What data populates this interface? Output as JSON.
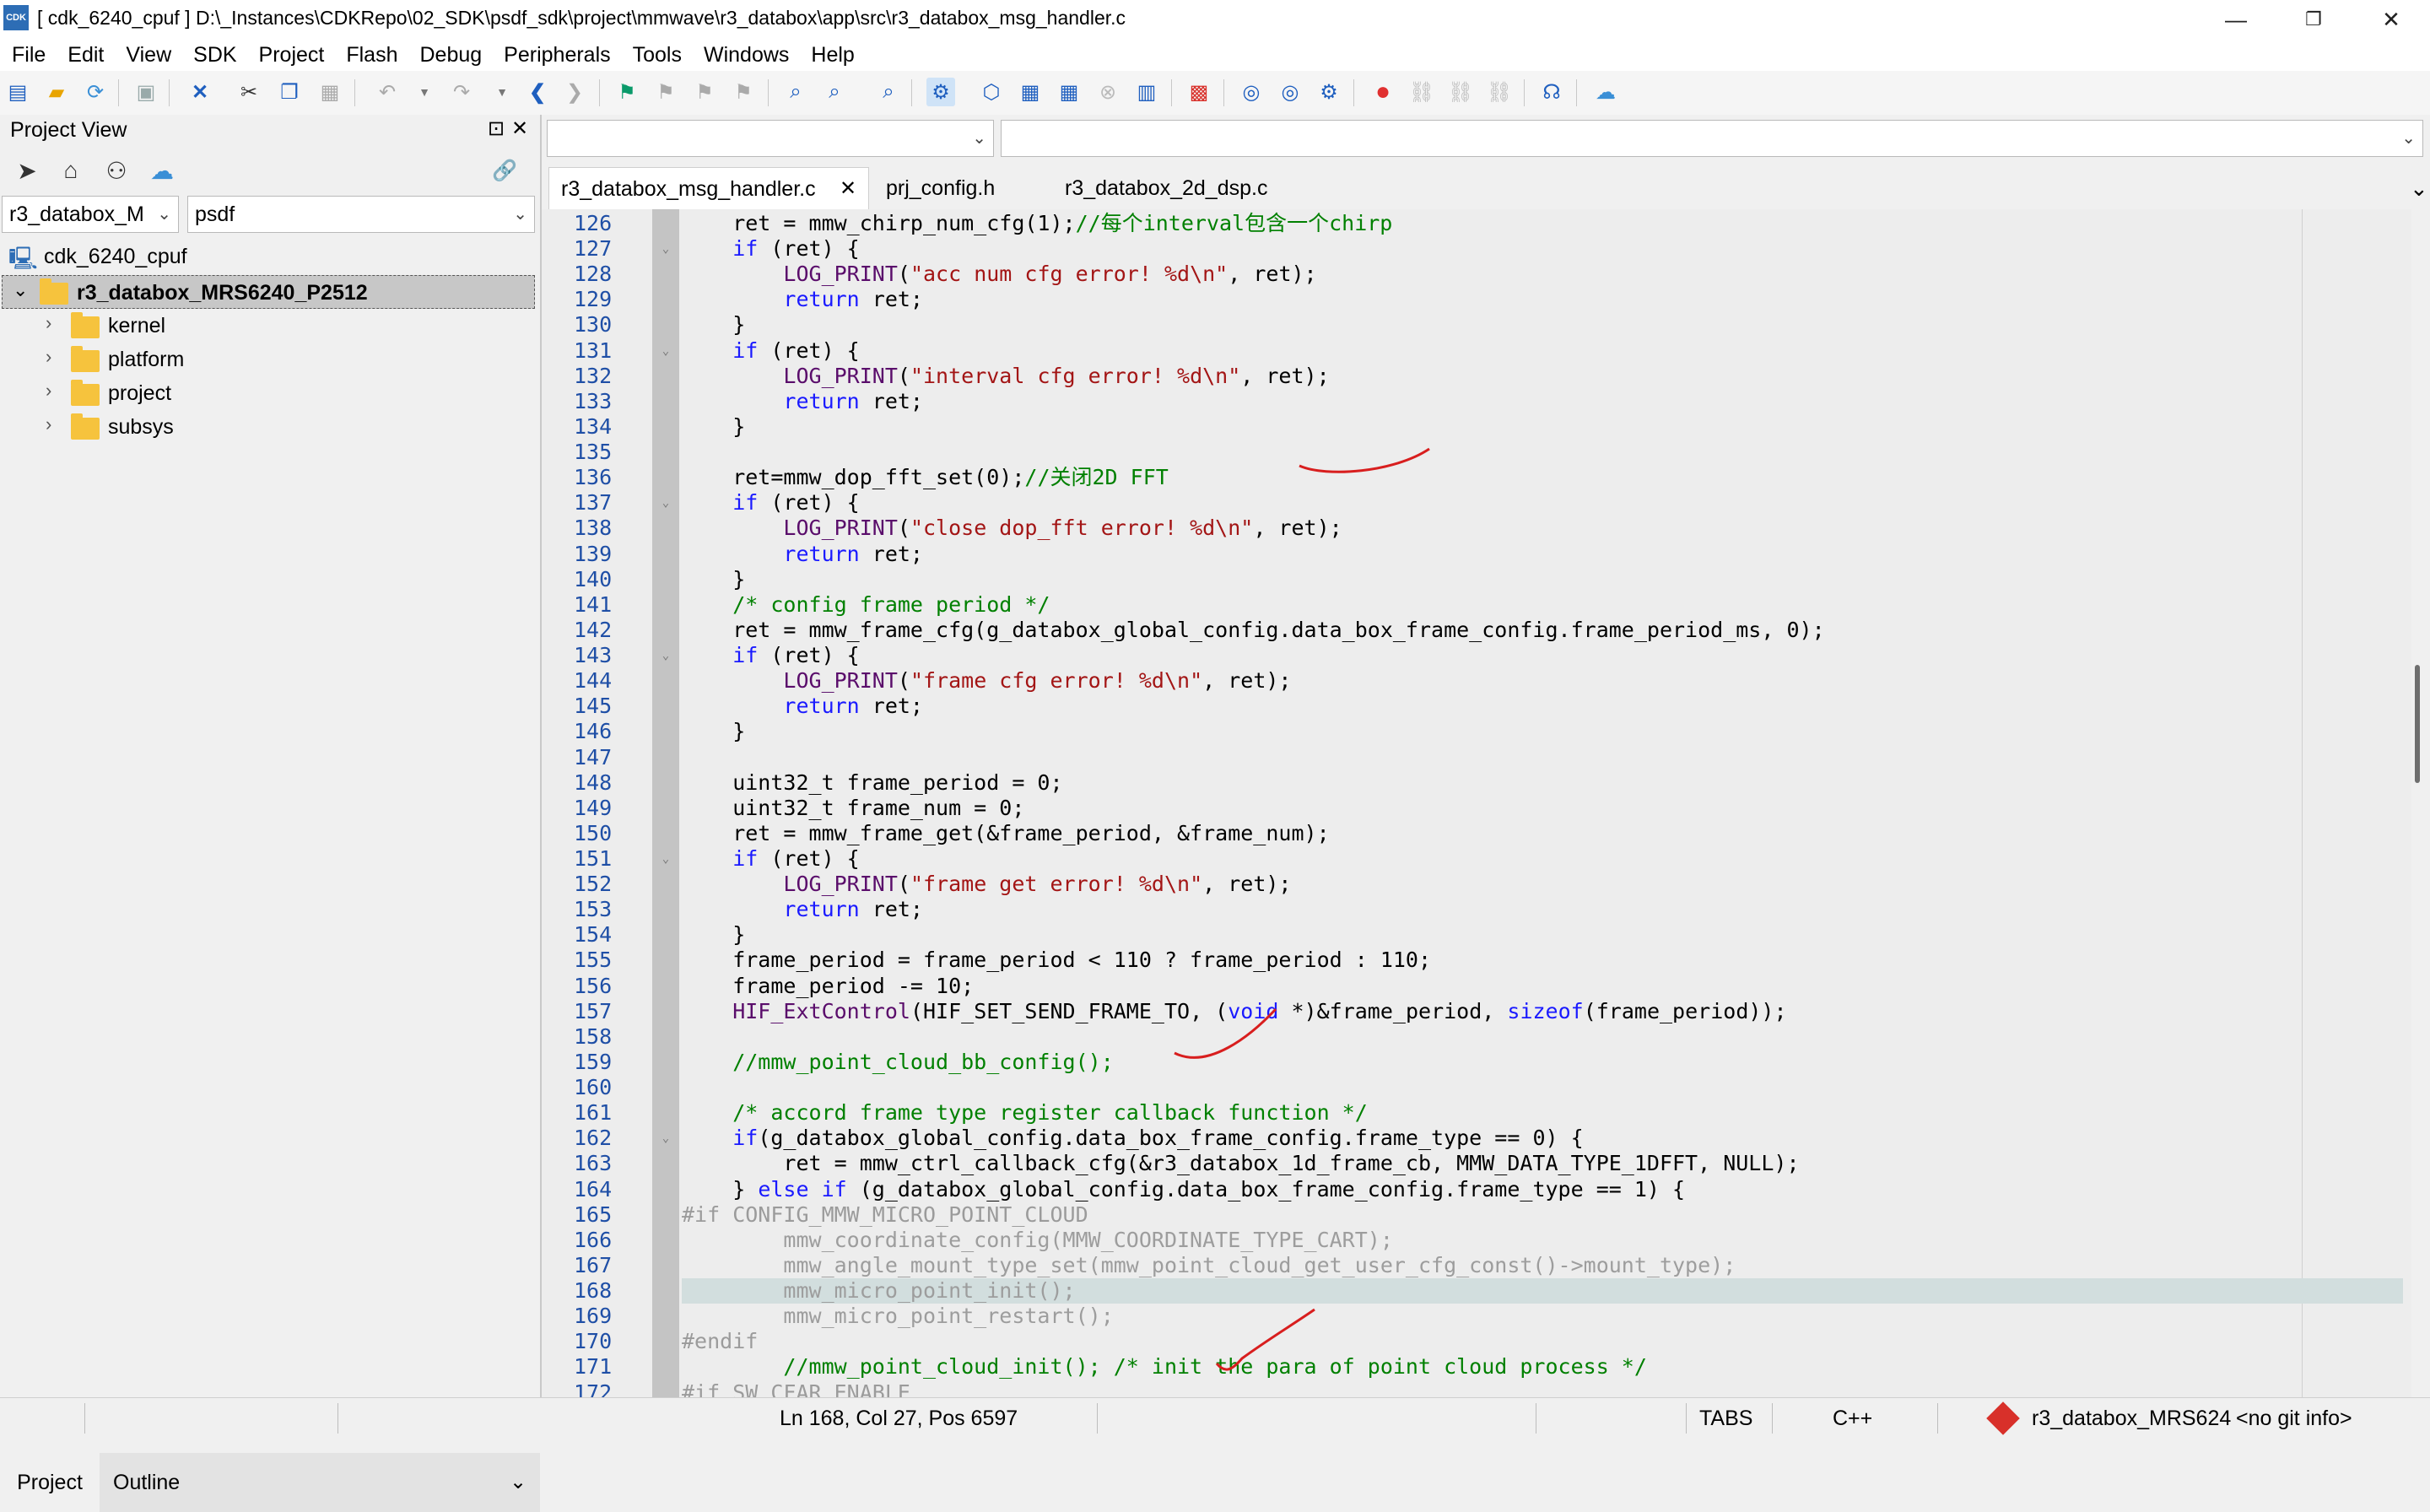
{
  "window": {
    "app_icon": "CDK",
    "title": "[ cdk_6240_cpuf ] D:\\_Instances\\CDKRepo\\02_SDK\\psdf_sdk\\project\\mmwave\\r3_databox\\app\\src\\r3_databox_msg_handler.c",
    "minimize": "—",
    "restore": "❐",
    "close": "✕"
  },
  "menu": [
    "File",
    "Edit",
    "View",
    "SDK",
    "Project",
    "Flash",
    "Debug",
    "Peripherals",
    "Tools",
    "Windows",
    "Help"
  ],
  "toolbar_icons": [
    "new-file-icon",
    "open-folder-icon",
    "refresh-icon",
    "save-icon",
    "close-x-icon",
    "cut-icon",
    "copy-icon",
    "paste-icon",
    "undo-icon",
    "undo-dropdown-icon",
    "redo-icon",
    "redo-dropdown-icon",
    "back-arrow-icon",
    "forward-arrow-icon",
    "flag-icon",
    "flag-prev-icon",
    "flag-next-icon",
    "flag-clear-icon",
    "find-icon",
    "find-in-files-icon",
    "search-replace-icon",
    "build-config-icon",
    "cube-icon",
    "build-icon",
    "rebuild-icon",
    "stop-build-icon",
    "clean-icon",
    "flash-chip-icon",
    "debug-icon",
    "debug-step-icon",
    "settings-gear-icon",
    "breakpoint-icon",
    "link-icon",
    "chain-icon",
    "unlink-icon",
    "headset-icon",
    "cloud-upload-icon"
  ],
  "project_view": {
    "title": "Project View",
    "pin": "⊡",
    "close": "✕",
    "tool_icons": [
      "navigate-icon",
      "home-icon",
      "hierarchy-icon",
      "cloud-icon"
    ],
    "link_icon": "🔗",
    "project_combo": "r3_databox_M",
    "config_combo": "psdf",
    "tree": {
      "workspace": "cdk_6240_cpuf",
      "project": "r3_databox_MRS6240_P2512",
      "folders": [
        "kernel",
        "platform",
        "project",
        "subsys"
      ]
    },
    "bottom_tabs": [
      "Project",
      "Outline"
    ]
  },
  "editor": {
    "combo_left": "",
    "combo_right": "",
    "tabs": [
      {
        "label": "r3_databox_msg_handler.c",
        "active": true,
        "close": "✕"
      },
      {
        "label": "prj_config.h",
        "active": false
      },
      {
        "label": "r3_databox_2d_dsp.c",
        "active": false
      }
    ],
    "tabs_overflow": "⌄",
    "highlighted_line": 168,
    "lines": [
      {
        "n": "126",
        "fold": false,
        "tokens": [
          [
            "n",
            "    ret = mmw_chirp_num_cfg(1);"
          ],
          [
            "c",
            "//每个interval包含一个chirp"
          ]
        ]
      },
      {
        "n": "127",
        "fold": true,
        "tokens": [
          [
            "k",
            "    if"
          ],
          [
            "n",
            " (ret) {"
          ]
        ]
      },
      {
        "n": "128",
        "fold": false,
        "tokens": [
          [
            "id",
            "        LOG_PRINT"
          ],
          [
            "n",
            "("
          ],
          [
            "s",
            "\"acc num cfg error! %d\\n\""
          ],
          [
            "n",
            ", ret);"
          ]
        ]
      },
      {
        "n": "129",
        "fold": false,
        "tokens": [
          [
            "k",
            "        return"
          ],
          [
            "n",
            " ret;"
          ]
        ]
      },
      {
        "n": "130",
        "fold": false,
        "tokens": [
          [
            "n",
            "    }"
          ]
        ]
      },
      {
        "n": "131",
        "fold": true,
        "tokens": [
          [
            "k",
            "    if"
          ],
          [
            "n",
            " (ret) {"
          ]
        ]
      },
      {
        "n": "132",
        "fold": false,
        "tokens": [
          [
            "id",
            "        LOG_PRINT"
          ],
          [
            "n",
            "("
          ],
          [
            "s",
            "\"interval cfg error! %d\\n\""
          ],
          [
            "n",
            ", ret);"
          ]
        ]
      },
      {
        "n": "133",
        "fold": false,
        "tokens": [
          [
            "k",
            "        return"
          ],
          [
            "n",
            " ret;"
          ]
        ]
      },
      {
        "n": "134",
        "fold": false,
        "tokens": [
          [
            "n",
            "    }"
          ]
        ]
      },
      {
        "n": "135",
        "fold": false,
        "tokens": [
          [
            "n",
            ""
          ]
        ]
      },
      {
        "n": "136",
        "fold": false,
        "tokens": [
          [
            "n",
            "    ret=mmw_dop_fft_set(0);"
          ],
          [
            "c",
            "//关闭2D FFT"
          ]
        ]
      },
      {
        "n": "137",
        "fold": true,
        "tokens": [
          [
            "k",
            "    if"
          ],
          [
            "n",
            " (ret) {"
          ]
        ]
      },
      {
        "n": "138",
        "fold": false,
        "tokens": [
          [
            "id",
            "        LOG_PRINT"
          ],
          [
            "n",
            "("
          ],
          [
            "s",
            "\"close dop_fft error! %d\\n\""
          ],
          [
            "n",
            ", ret);"
          ]
        ]
      },
      {
        "n": "139",
        "fold": false,
        "tokens": [
          [
            "k",
            "        return"
          ],
          [
            "n",
            " ret;"
          ]
        ]
      },
      {
        "n": "140",
        "fold": false,
        "tokens": [
          [
            "n",
            "    }"
          ]
        ]
      },
      {
        "n": "141",
        "fold": false,
        "tokens": [
          [
            "c",
            "    /* config frame period */"
          ]
        ]
      },
      {
        "n": "142",
        "fold": false,
        "tokens": [
          [
            "n",
            "    ret = mmw_frame_cfg(g_databox_global_config.data_box_frame_config.frame_period_ms, 0);"
          ]
        ]
      },
      {
        "n": "143",
        "fold": true,
        "tokens": [
          [
            "k",
            "    if"
          ],
          [
            "n",
            " (ret) {"
          ]
        ]
      },
      {
        "n": "144",
        "fold": false,
        "tokens": [
          [
            "id",
            "        LOG_PRINT"
          ],
          [
            "n",
            "("
          ],
          [
            "s",
            "\"frame cfg error! %d\\n\""
          ],
          [
            "n",
            ", ret);"
          ]
        ]
      },
      {
        "n": "145",
        "fold": false,
        "tokens": [
          [
            "k",
            "        return"
          ],
          [
            "n",
            " ret;"
          ]
        ]
      },
      {
        "n": "146",
        "fold": false,
        "tokens": [
          [
            "n",
            "    }"
          ]
        ]
      },
      {
        "n": "147",
        "fold": false,
        "tokens": [
          [
            "n",
            ""
          ]
        ]
      },
      {
        "n": "148",
        "fold": false,
        "tokens": [
          [
            "n",
            "    uint32_t frame_period = 0;"
          ]
        ]
      },
      {
        "n": "149",
        "fold": false,
        "tokens": [
          [
            "n",
            "    uint32_t frame_num = 0;"
          ]
        ]
      },
      {
        "n": "150",
        "fold": false,
        "tokens": [
          [
            "n",
            "    ret = mmw_frame_get(&frame_period, &frame_num);"
          ]
        ]
      },
      {
        "n": "151",
        "fold": true,
        "tokens": [
          [
            "k",
            "    if"
          ],
          [
            "n",
            " (ret) {"
          ]
        ]
      },
      {
        "n": "152",
        "fold": false,
        "tokens": [
          [
            "id",
            "        LOG_PRINT"
          ],
          [
            "n",
            "("
          ],
          [
            "s",
            "\"frame get error! %d\\n\""
          ],
          [
            "n",
            ", ret);"
          ]
        ]
      },
      {
        "n": "153",
        "fold": false,
        "tokens": [
          [
            "k",
            "        return"
          ],
          [
            "n",
            " ret;"
          ]
        ]
      },
      {
        "n": "154",
        "fold": false,
        "tokens": [
          [
            "n",
            "    }"
          ]
        ]
      },
      {
        "n": "155",
        "fold": false,
        "tokens": [
          [
            "n",
            "    frame_period = frame_period < 110 ? frame_period : 110;"
          ]
        ]
      },
      {
        "n": "156",
        "fold": false,
        "tokens": [
          [
            "n",
            "    frame_period -= 10;"
          ]
        ]
      },
      {
        "n": "157",
        "fold": false,
        "tokens": [
          [
            "id",
            "    HIF_ExtControl"
          ],
          [
            "n",
            "(HIF_SET_SEND_FRAME_TO, ("
          ],
          [
            "k",
            "void"
          ],
          [
            "n",
            " *)&frame_period, "
          ],
          [
            "k",
            "sizeof"
          ],
          [
            "n",
            "(frame_period));"
          ]
        ]
      },
      {
        "n": "158",
        "fold": false,
        "tokens": [
          [
            "n",
            ""
          ]
        ]
      },
      {
        "n": "159",
        "fold": false,
        "tokens": [
          [
            "c",
            "    //mmw_point_cloud_bb_config();"
          ]
        ]
      },
      {
        "n": "160",
        "fold": false,
        "tokens": [
          [
            "n",
            ""
          ]
        ]
      },
      {
        "n": "161",
        "fold": false,
        "tokens": [
          [
            "c",
            "    /* accord frame type register callback function */"
          ]
        ]
      },
      {
        "n": "162",
        "fold": true,
        "tokens": [
          [
            "k",
            "    if"
          ],
          [
            "n",
            "(g_databox_global_config.data_box_frame_config.frame_type == 0) {"
          ]
        ]
      },
      {
        "n": "163",
        "fold": false,
        "tokens": [
          [
            "n",
            "        ret = mmw_ctrl_callback_cfg(&r3_databox_1d_frame_cb, MMW_DATA_TYPE_1DFFT, NULL);"
          ]
        ]
      },
      {
        "n": "164",
        "fold": false,
        "tokens": [
          [
            "n",
            "    } "
          ],
          [
            "k",
            "else if"
          ],
          [
            "n",
            " (g_databox_global_config.data_box_frame_config.frame_type == 1) {"
          ]
        ]
      },
      {
        "n": "165",
        "fold": false,
        "tokens": [
          [
            "pp",
            "#if CONFIG_MMW_MICRO_POINT_CLOUD"
          ]
        ]
      },
      {
        "n": "166",
        "fold": false,
        "tokens": [
          [
            "dim",
            "        mmw_coordinate_config(MMW_COORDINATE_TYPE_CART);"
          ]
        ]
      },
      {
        "n": "167",
        "fold": false,
        "tokens": [
          [
            "dim",
            "        mmw_angle_mount_type_set(mmw_point_cloud_get_user_cfg_const()->mount_type);"
          ]
        ]
      },
      {
        "n": "168",
        "fold": false,
        "tokens": [
          [
            "dim",
            "        mmw_micro_point_init();"
          ]
        ]
      },
      {
        "n": "169",
        "fold": false,
        "tokens": [
          [
            "dim",
            "        mmw_micro_point_restart();"
          ]
        ]
      },
      {
        "n": "170",
        "fold": false,
        "tokens": [
          [
            "pp",
            "#endif"
          ]
        ]
      },
      {
        "n": "171",
        "fold": false,
        "tokens": [
          [
            "c",
            "        //mmw_point_cloud_init(); /* init the para of point cloud process */"
          ]
        ]
      },
      {
        "n": "172",
        "fold": false,
        "tokens": [
          [
            "pp",
            "#if SW_CFAR_ENABLE"
          ]
        ]
      }
    ]
  },
  "statusbar": {
    "position": "Ln 168, Col 27, Pos 6597",
    "tabs_mode": "TABS",
    "language": "C++",
    "git_icon": "git-icon",
    "project": "r3_databox_MRS624",
    "git_info": "<no git info>"
  },
  "colors": {
    "keyword": "#1a1aff",
    "comment": "#008000",
    "string": "#a31515",
    "function": "#5a0d6b",
    "line_number": "#1f4fa6",
    "annotation_ink": "#d81e1e"
  }
}
